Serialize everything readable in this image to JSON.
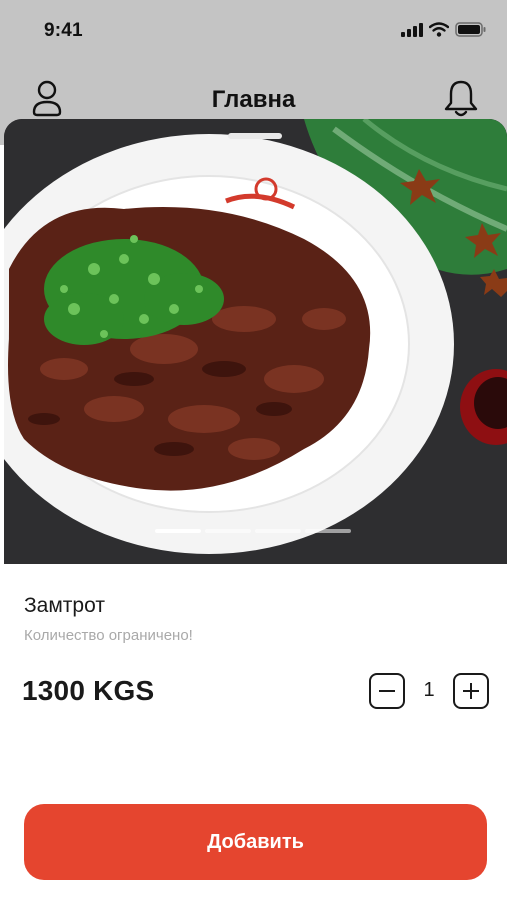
{
  "status_bar": {
    "time": "9:41",
    "icons": [
      "signal-icon",
      "wifi-icon",
      "battery-icon"
    ]
  },
  "nav": {
    "title": "Главна",
    "left_icon": "profile-icon",
    "right_icon": "bell-icon"
  },
  "hero": {
    "image": "photo of glazed beef strips with green onions on a white plate",
    "carousel_pages": 4,
    "active_page": 1
  },
  "product": {
    "name": "Замтрот",
    "note": "Количество ограничено!",
    "price": "1300 KGS",
    "quantity": "1"
  },
  "actions": {
    "add_label": "Добавить"
  },
  "colors": {
    "accent": "#e5452f",
    "header_bg": "#c4c4c4",
    "muted_text": "#a9a9a9"
  }
}
